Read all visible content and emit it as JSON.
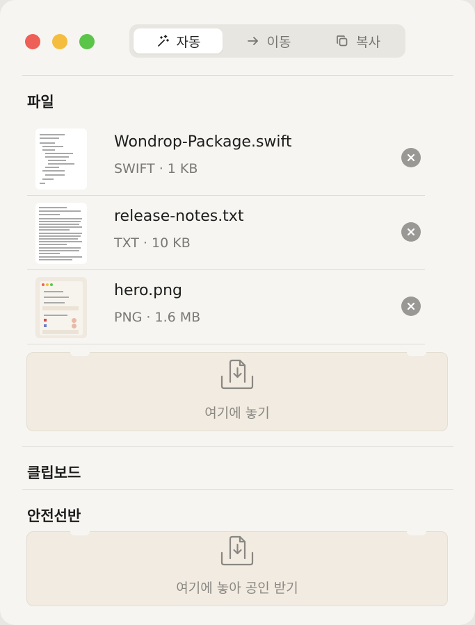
{
  "toolbar": {
    "tabs": [
      {
        "label": "자동",
        "icon": "magic-wand-icon",
        "active": true
      },
      {
        "label": "이동",
        "icon": "arrow-right-icon",
        "active": false
      },
      {
        "label": "복사",
        "icon": "copy-icon",
        "active": false
      }
    ]
  },
  "files_section": {
    "title": "파일",
    "files": [
      {
        "name": "Wondrop-Package.swift",
        "meta": "SWIFT · 1 KB"
      },
      {
        "name": "release-notes.txt",
        "meta": "TXT · 10 KB"
      },
      {
        "name": "hero.png",
        "meta": "PNG · 1.6 MB"
      }
    ],
    "dropzone_label": "여기에 놓기"
  },
  "clipboard_section": {
    "title": "클립보드"
  },
  "shelf_section": {
    "title": "안전선반",
    "dropzone_label": "여기에 놓아 공인 받기"
  },
  "colors": {
    "close": "#ed5f57",
    "minimize": "#f4bd3e",
    "zoom": "#5bc54a",
    "dropzone_bg": "#f1ebe1",
    "window_bg": "#f6f5f1"
  }
}
